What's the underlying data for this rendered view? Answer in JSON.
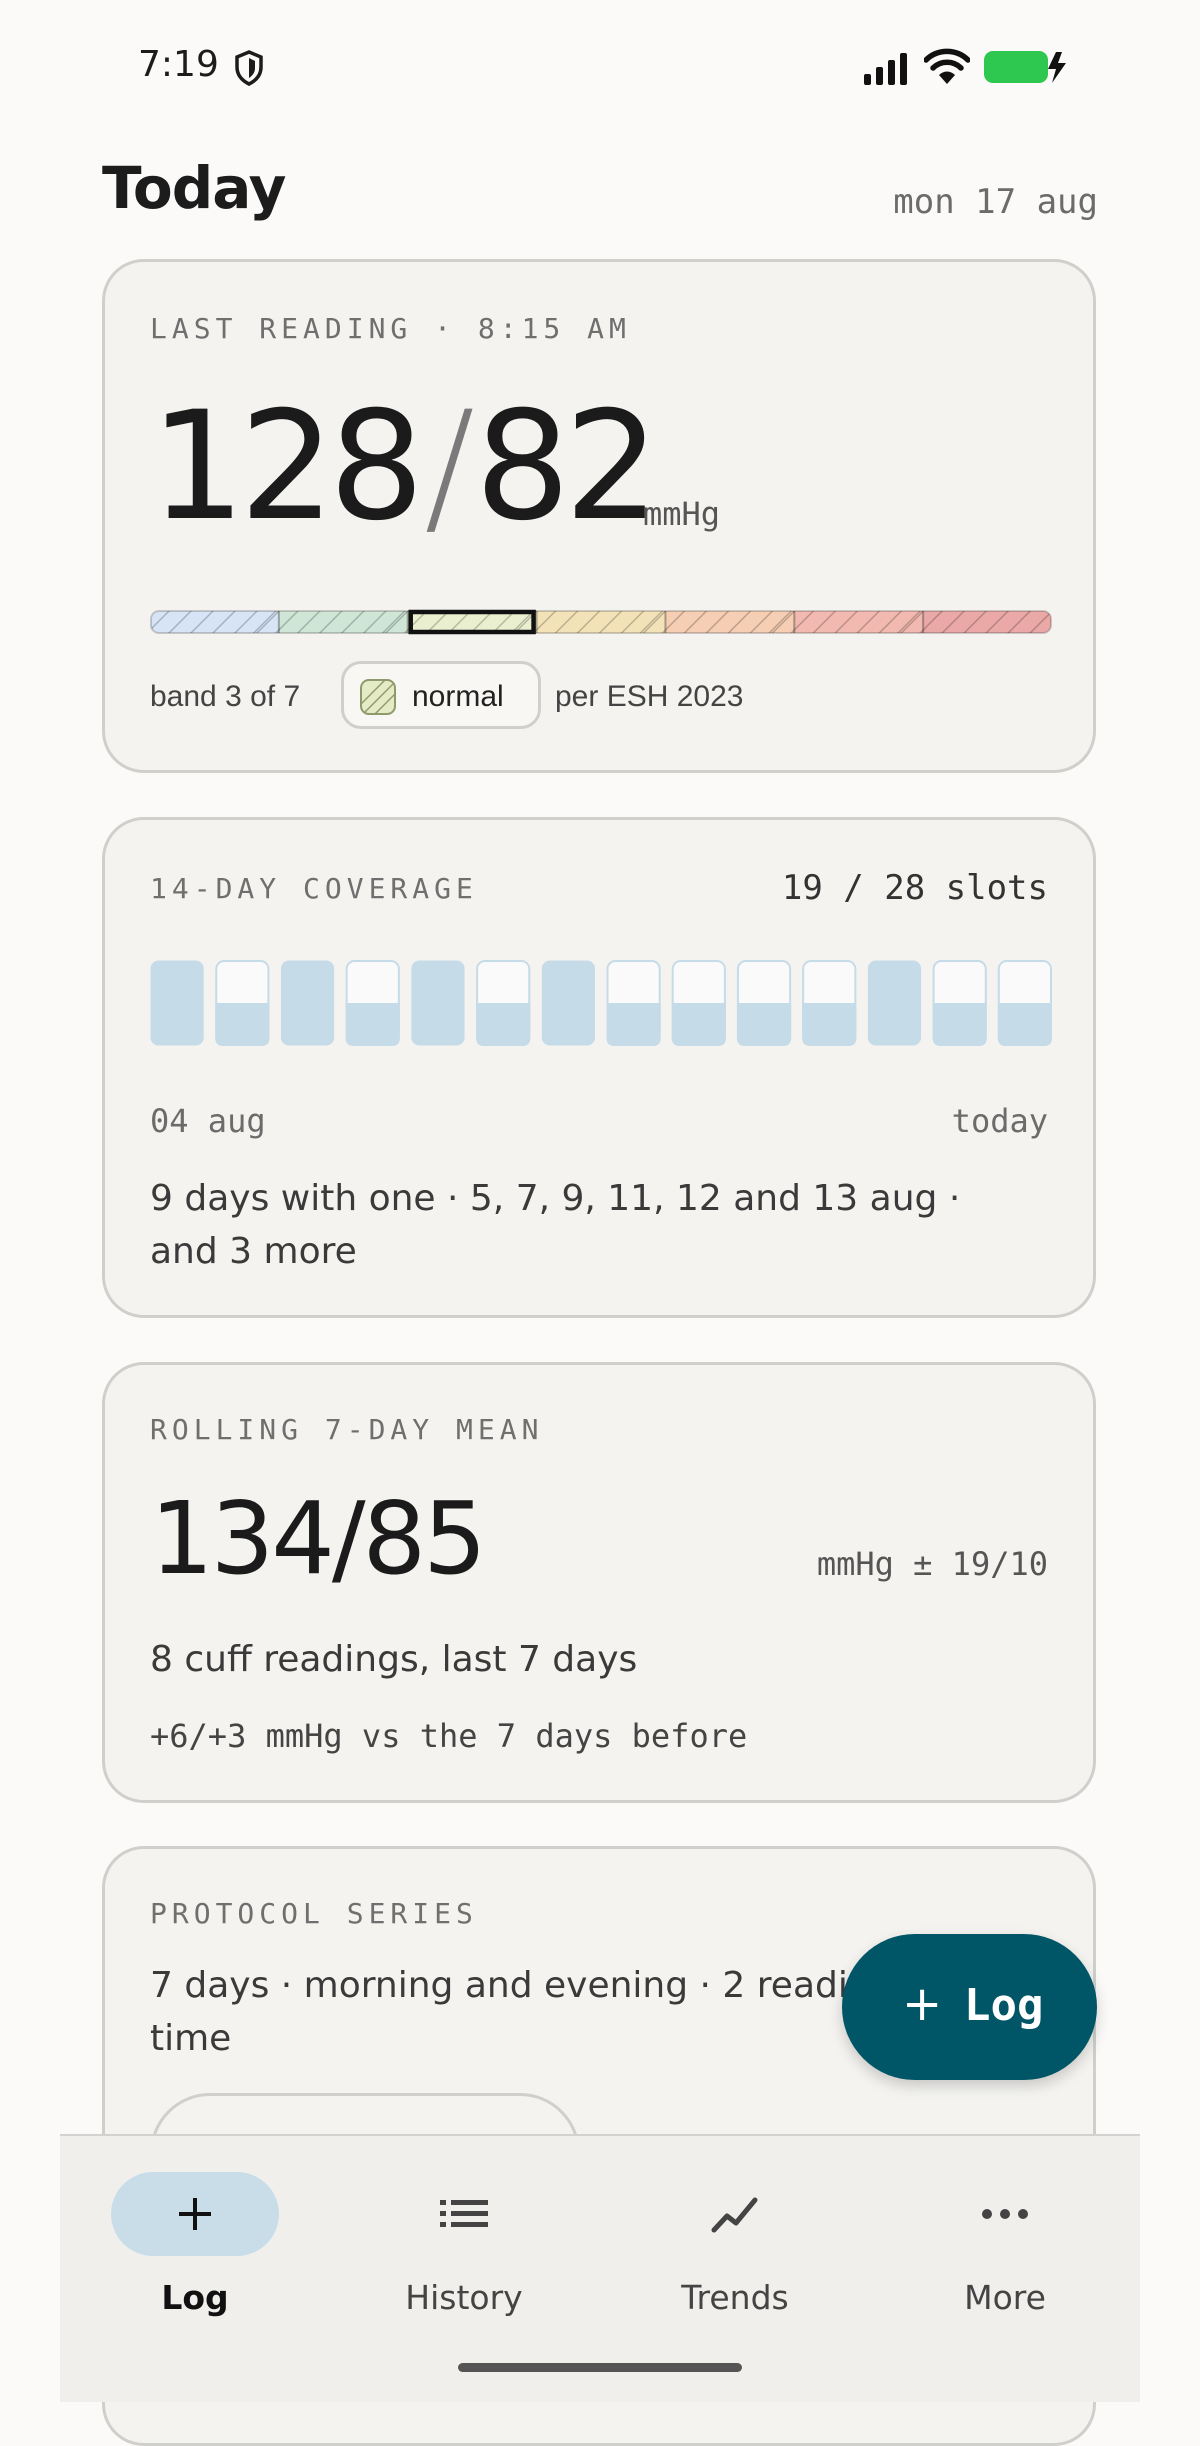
{
  "status_bar": {
    "time": "7:19"
  },
  "header": {
    "title": "Today",
    "date": "mon 17 aug"
  },
  "last_reading": {
    "label": "LAST READING · 8:15 AM",
    "systolic": "128",
    "diastolic": "82",
    "unit": "mmHg",
    "band_caption": "band 3 of 7",
    "band_name": "normal",
    "band_source": "per ESH 2023",
    "band_index": 3,
    "band_count": 7,
    "band_colors": [
      "#d6e4f5",
      "#cfe6d6",
      "#e9efcf",
      "#f3e2b8",
      "#f5ceb3",
      "#f1b9b0",
      "#eaa9a6"
    ]
  },
  "coverage": {
    "label": "14-DAY COVERAGE",
    "count": "19 / 28 slots",
    "days_filled": [
      2,
      1,
      2,
      1,
      2,
      1,
      2,
      1,
      1,
      1,
      1,
      2,
      1,
      1
    ],
    "start_label": "04 aug",
    "end_label": "today",
    "note": "9 days with one · 5, 7, 9, 11, 12 and 13 aug · and 3 more"
  },
  "rolling_mean": {
    "label": "ROLLING 7-DAY MEAN",
    "value": "134/85",
    "unit": "mmHg ± 19/10",
    "count": "8 cuff readings, last 7 days",
    "delta": "+6/+3 mmHg vs the 7 days before"
  },
  "protocol": {
    "label": "PROTOCOL SERIES",
    "description": "7 days · morning and evening · 2 readings each time"
  },
  "fab": {
    "label": "Log"
  },
  "nav": {
    "items": [
      {
        "label": "Log",
        "icon": "plus-icon"
      },
      {
        "label": "History",
        "icon": "list-icon"
      },
      {
        "label": "Trends",
        "icon": "trend-icon"
      },
      {
        "label": "More",
        "icon": "more-icon"
      }
    ],
    "active": "Log"
  }
}
